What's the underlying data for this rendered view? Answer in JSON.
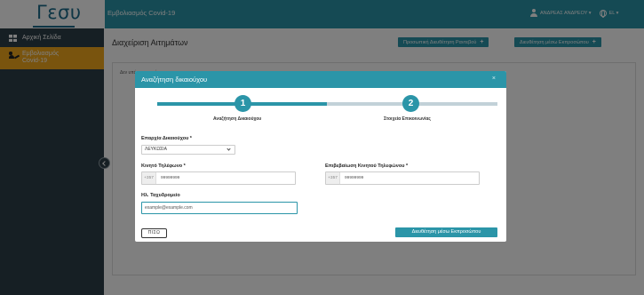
{
  "header": {
    "logo_text": "Γεσυ",
    "app_title": "Εμβολιασμός Covid-19",
    "user_name": "ΑΝΔΡΕΑΣ ΑΝΔΡΕΟΥ ▾",
    "language": "EL ▾",
    "accent_color": "#2b95a8"
  },
  "sidebar": {
    "items": [
      {
        "label": "Αρχική Σελίδα",
        "icon": "grid-icon",
        "active": false
      },
      {
        "label_line1": "Εμβολιασμός",
        "label_line2": "Covid-19",
        "icon": "syringe-icon",
        "active": true
      }
    ]
  },
  "main": {
    "page_title": "Διαχείριση Αιτημάτων",
    "buttons": {
      "personal_rv": "Προσωπική Διευθέτηση Ραντεβού",
      "representative": "Διευθέτηση μέσω Εκπροσώπου"
    },
    "panel_text": "Δεν υπάρχουν αιτήματα"
  },
  "modal": {
    "title": "Αναζήτηση δικαιούχου",
    "close": "×",
    "steps": [
      {
        "number": "1",
        "label": "Αναζήτηση Δικαιούχου",
        "complete": true
      },
      {
        "number": "2",
        "label": "Στοιχεία Επικοινωνίας",
        "complete": false
      }
    ],
    "province": {
      "label": "Επαρχία Δικαιούχου *",
      "value": "ΛΕΥΚΩΣΙΑ"
    },
    "mobile": {
      "label": "Κινητό Τηλέφωνο *",
      "prefix": "+357",
      "placeholder": "99999999"
    },
    "mobile_confirm": {
      "label": "Επιβεβαίωση Κινητού Τηλεφώνου *",
      "prefix": "+357",
      "placeholder": "99999999"
    },
    "email": {
      "label": "Ηλ. Ταχυδρομείο",
      "placeholder": "example@example.com"
    },
    "back_button": "ΠΙΣΩ",
    "submit_button": "Διευθέτηση μέσω Εκπροσώπου"
  }
}
